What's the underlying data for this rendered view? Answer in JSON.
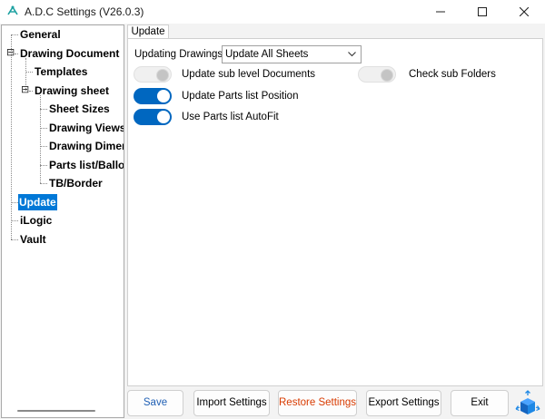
{
  "window": {
    "title": "A.D.C Settings (V26.0.3)"
  },
  "tree": {
    "nodes": {
      "general": "General",
      "drawing_document": "Drawing Document",
      "templates": "Templates",
      "drawing_sheet": "Drawing sheet",
      "sheet_sizes": "Sheet Sizes",
      "drawing_views": "Drawing Views",
      "drawing_dimen": "Drawing Dimen",
      "parts_list": "Parts list/Balloo",
      "tb_border": "TB/Border",
      "update": "Update",
      "ilogic": "iLogic",
      "vault": "Vault"
    },
    "selected": "Update",
    "expand_symbol": "⊟"
  },
  "tab": {
    "label": "Update"
  },
  "update_page": {
    "updating_drawings_label": "Updating Drawings",
    "updating_drawings_value": "Update All Sheets",
    "toggles": {
      "sub_level_documents": {
        "label": "Update sub level Documents",
        "on": false
      },
      "check_sub_folders": {
        "label": "Check sub Folders",
        "on": false
      },
      "parts_list_position": {
        "label": "Update Parts list Position",
        "on": true
      },
      "parts_list_autofit": {
        "label": "Use Parts list AutoFit",
        "on": true
      }
    }
  },
  "buttons": {
    "save": "Save",
    "import": "Import Settings",
    "restore": "Restore Settings",
    "export": "Export Settings",
    "exit": "Exit"
  },
  "colors": {
    "accent": "#0067c0",
    "selection": "#0078d7",
    "restore_text": "#d83b01",
    "save_text": "#1f5fb4"
  }
}
